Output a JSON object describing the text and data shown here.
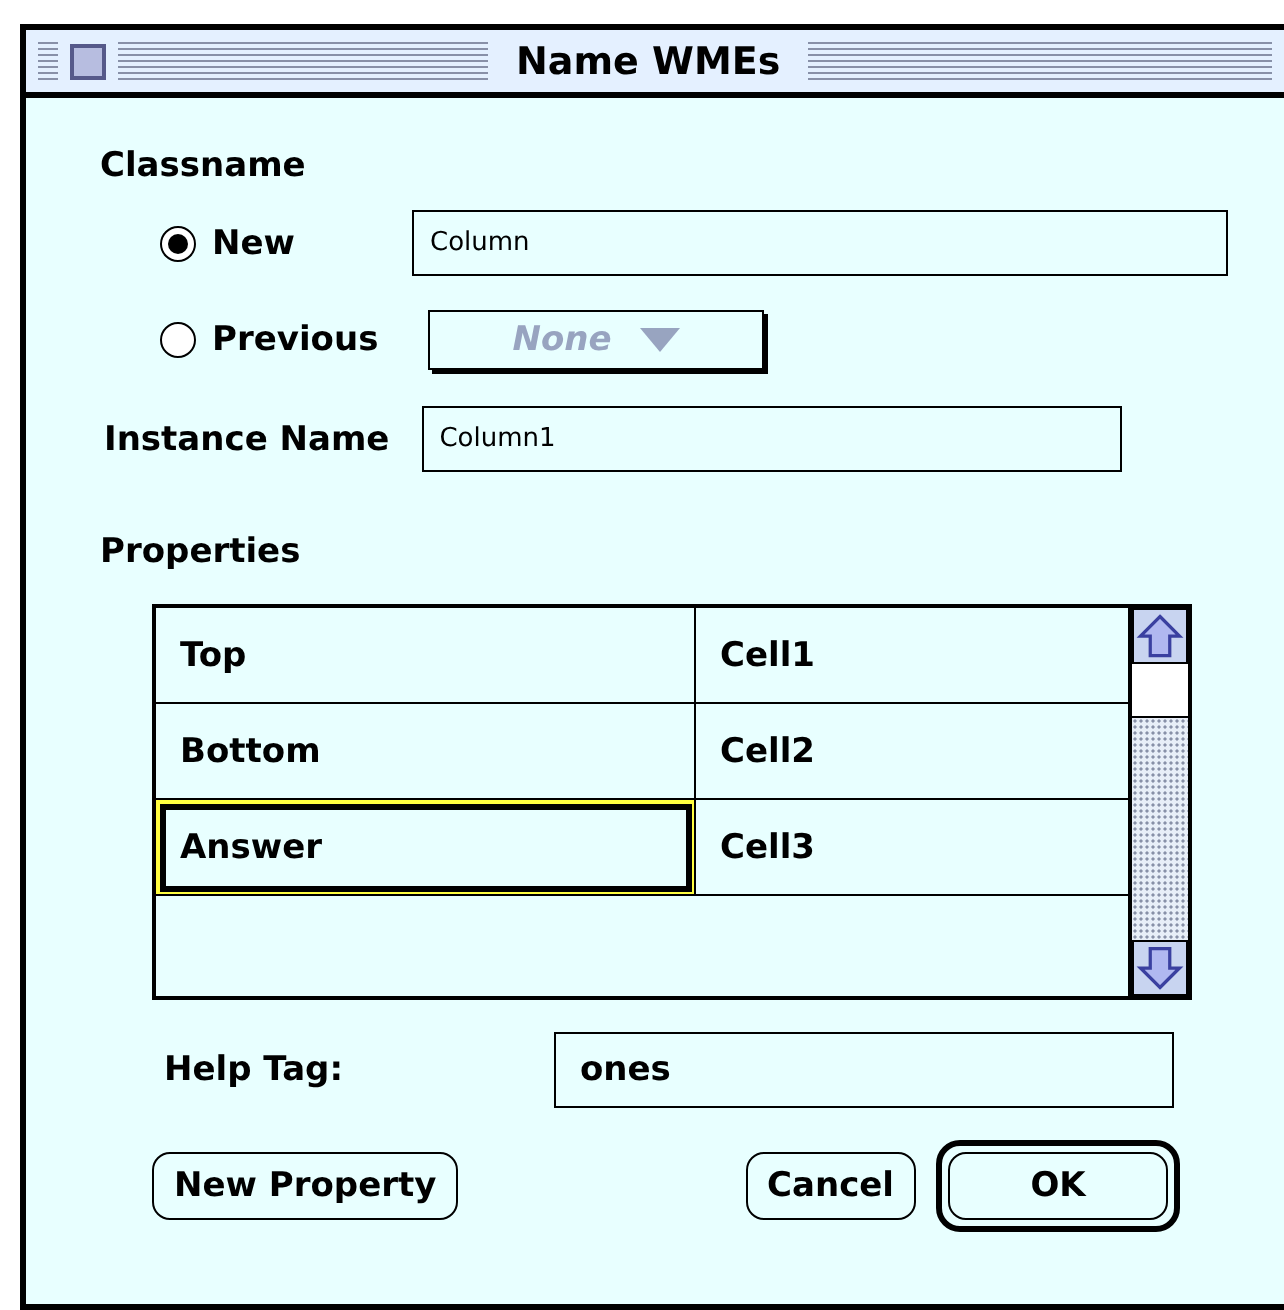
{
  "window": {
    "title": "Name WMEs"
  },
  "classname": {
    "label": "Classname",
    "options": [
      {
        "label": "New",
        "selected": true,
        "kind": "field",
        "value": "Column"
      },
      {
        "label": "Previous",
        "selected": false,
        "kind": "dropdown",
        "value": "None",
        "disabled": true
      }
    ]
  },
  "instance_name": {
    "label": "Instance Name",
    "value": "Column1"
  },
  "properties": {
    "label": "Properties",
    "rows": [
      {
        "name": "Top",
        "value": "Cell1",
        "selected": false
      },
      {
        "name": "Bottom",
        "value": "Cell2",
        "selected": false
      },
      {
        "name": "Answer",
        "value": "Cell3",
        "selected": true
      }
    ]
  },
  "help_tag": {
    "label": "Help Tag:",
    "value": "ones"
  },
  "buttons": [
    {
      "label": "New Property",
      "default": false
    },
    {
      "label": "Cancel",
      "default": false
    },
    {
      "label": "OK",
      "default": true
    }
  ]
}
